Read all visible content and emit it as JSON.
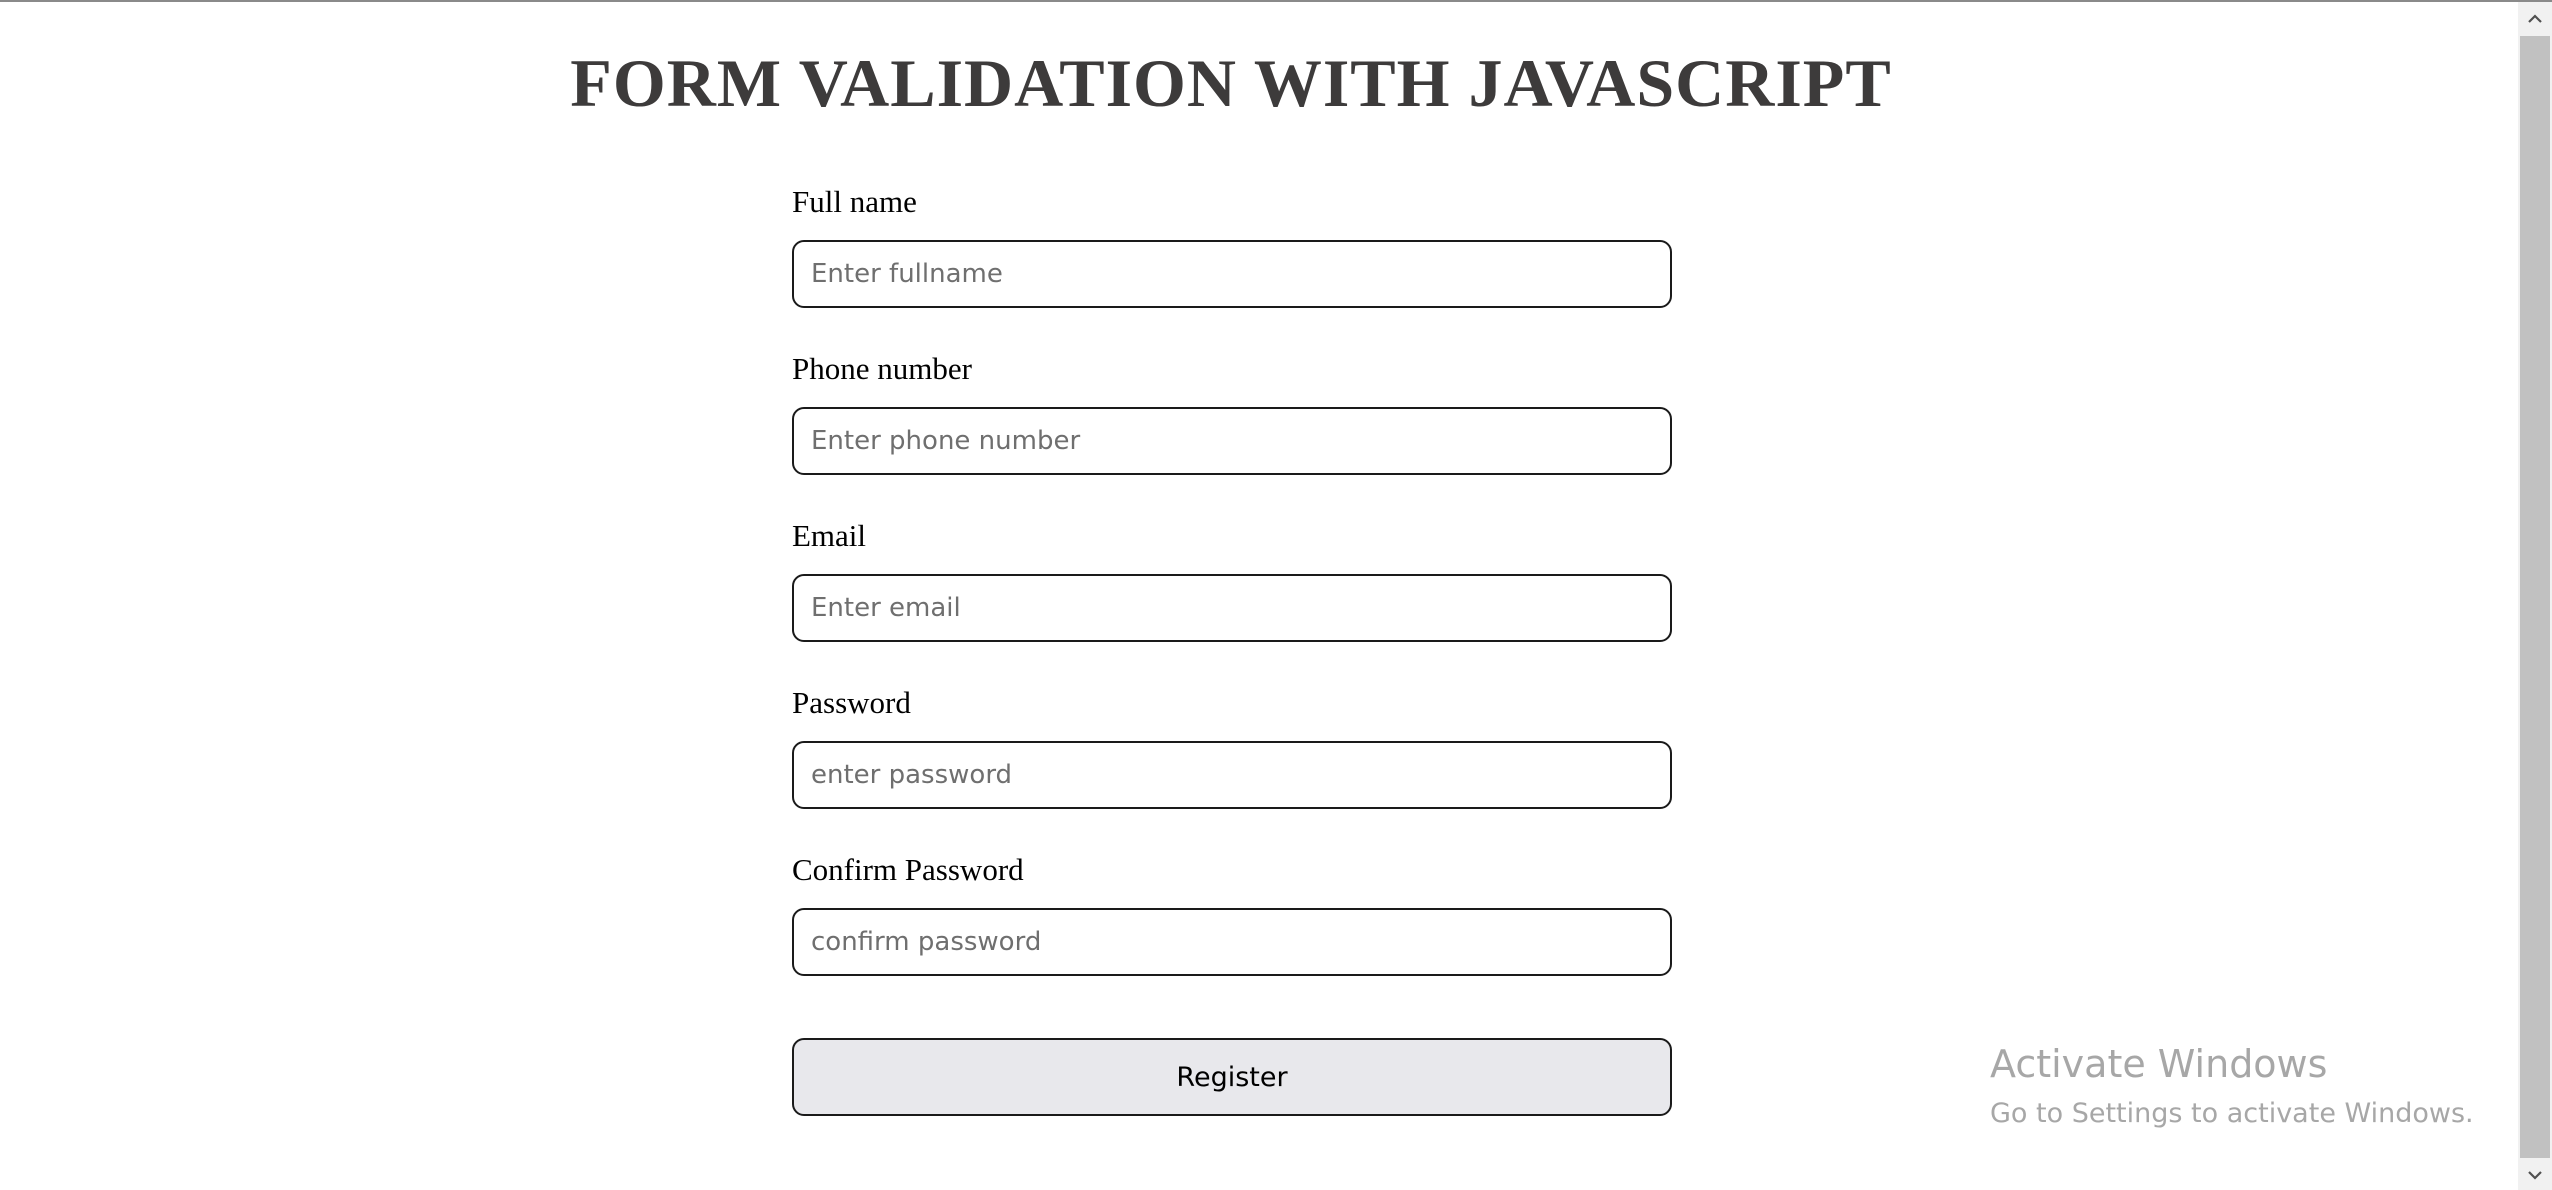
{
  "page": {
    "title": "FORM VALIDATION WITH JAVASCRIPT"
  },
  "form": {
    "fields": [
      {
        "label": "Full name",
        "placeholder": "Enter fullname",
        "value": ""
      },
      {
        "label": "Phone number",
        "placeholder": "Enter phone number",
        "value": ""
      },
      {
        "label": "Email",
        "placeholder": "Enter email",
        "value": ""
      },
      {
        "label": "Password",
        "placeholder": "enter password",
        "value": ""
      },
      {
        "label": "Confirm Password",
        "placeholder": "confirm password",
        "value": ""
      }
    ],
    "submit_label": "Register"
  },
  "watermark": {
    "title": "Activate Windows",
    "subtitle": "Go to Settings to activate Windows."
  },
  "scrollbar": {
    "up_icon": "chevron-up-icon",
    "down_icon": "chevron-down-icon"
  },
  "colors": {
    "title": "#3d3b3b",
    "input_border": "#1a1a1a",
    "button_bg": "#e8e8ec",
    "watermark": "#a7a7a7"
  }
}
